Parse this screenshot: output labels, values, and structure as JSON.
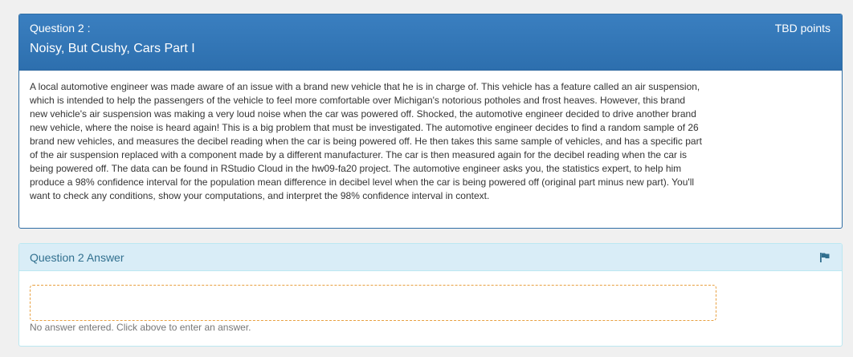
{
  "question": {
    "number_label": "Question 2 :",
    "title": "Noisy, But Cushy, Cars Part I",
    "points": "TBD points",
    "body": "A local automotive engineer was made aware of an issue with a brand new vehicle that he is in charge of. This vehicle has a feature called an air suspension, which is intended to help the passengers of the vehicle to feel more comfortable over Michigan's notorious potholes and frost heaves. However, this brand new vehicle's air suspension was making a very loud noise when the car was powered off. Shocked, the automotive engineer decided to drive another brand new vehicle, where the noise is heard again! This is a big problem that must be investigated. The automotive engineer decides to find a random sample of 26 brand new vehicles, and measures the decibel reading when the car is being powered off. He then takes this same sample of vehicles, and has a specific part of the air suspension replaced with a component made by a different manufacturer. The car is then measured again for the decibel reading when the car is being powered off. The data can be found in RStudio Cloud in the hw09-fa20 project. The automotive engineer asks you, the statistics expert, to help him produce a 98% confidence interval for the population mean difference in decibel level when the car is being powered off (original part minus new part). You'll want to check any conditions, show your computations, and interpret the 98% confidence interval in context."
  },
  "answer": {
    "title": "Question 2 Answer",
    "flag_icon": "flag-icon",
    "placeholder": "No answer entered. Click above to enter an answer."
  },
  "colors": {
    "header_blue": "#2d6fae",
    "answer_header_bg": "#d9edf7",
    "answer_title": "#31708f",
    "answer_box_border": "#e8a040"
  }
}
